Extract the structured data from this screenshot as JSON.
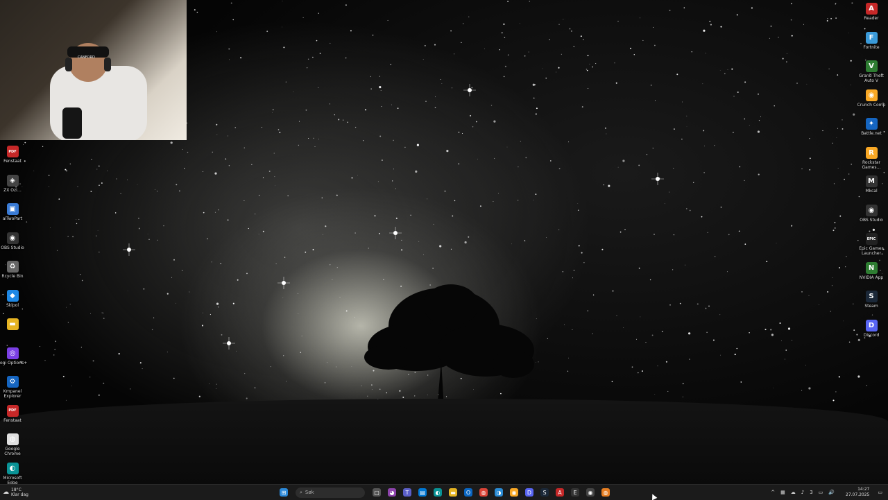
{
  "webcam": {
    "cap_text": "CANFORD"
  },
  "left_icons": [
    {
      "name": "pdf-app",
      "label": "Fenstaat",
      "color": "#c62828",
      "glyph": "PDF"
    },
    {
      "name": "rainmeter",
      "label": "ZX Ozi…",
      "color": "#444",
      "glyph": "◈"
    },
    {
      "name": "network-app",
      "label": "alTwoPart",
      "color": "#3a7bd5",
      "glyph": "▣"
    },
    {
      "name": "obs-studio",
      "label": "OBS Studio",
      "color": "#333",
      "glyph": "◉"
    },
    {
      "name": "recycle-bin",
      "label": "Rcycle Bin",
      "color": "#666",
      "glyph": "♻"
    },
    {
      "name": "shortcut-app",
      "label": "Sklpol",
      "color": "#1e88e5",
      "glyph": "◆"
    },
    {
      "name": "folder",
      "label": "",
      "color": "#e6b422",
      "glyph": "▬"
    },
    {
      "name": "logi-options",
      "label": "Logi Options+",
      "color": "#7b3fe4",
      "glyph": "◎"
    },
    {
      "name": "control-panel",
      "label": "Kmpanel Explorer",
      "color": "#1565c0",
      "glyph": "⚙"
    },
    {
      "name": "pdf-app-2",
      "label": "Fenstaat",
      "color": "#c62828",
      "glyph": "PDF"
    },
    {
      "name": "google-chrome",
      "label": "Google Chrome",
      "color": "#e0e0e0",
      "glyph": "◍"
    },
    {
      "name": "microsoft-edge",
      "label": "Microsoft Edge",
      "color": "#0a9396",
      "glyph": "◐"
    }
  ],
  "right_icons": [
    {
      "name": "adobe-reader",
      "label": "Reader",
      "color": "#c62828",
      "glyph": "A"
    },
    {
      "name": "fortnite",
      "label": "Fortnite",
      "color": "#3a9ad9",
      "glyph": "F"
    },
    {
      "name": "gta-v",
      "label": "Grand Theft Auto V",
      "color": "#2e7d32",
      "glyph": "V"
    },
    {
      "name": "crunchy-app",
      "label": "Crunch Comp",
      "color": "#f9a825",
      "glyph": "◉"
    },
    {
      "name": "battlenet",
      "label": "Battle.net",
      "color": "#1565c0",
      "glyph": "✦"
    },
    {
      "name": "rockstar-games",
      "label": "Rockstar Games…",
      "color": "#f9a825",
      "glyph": "R"
    },
    {
      "name": "mail-app",
      "label": "Mkcal",
      "color": "#333",
      "glyph": "M"
    },
    {
      "name": "obs-studio-2",
      "label": "OBS Studio",
      "color": "#333",
      "glyph": "◉"
    },
    {
      "name": "epic-games",
      "label": "Epic Games Launcher",
      "color": "#222",
      "glyph": "EPIC"
    },
    {
      "name": "nvidia-app",
      "label": "NVIDIA App",
      "color": "#2e7d32",
      "glyph": "N"
    },
    {
      "name": "steam",
      "label": "Steam",
      "color": "#1b2838",
      "glyph": "S"
    },
    {
      "name": "discord",
      "label": "Discord",
      "color": "#5865f2",
      "glyph": "D"
    }
  ],
  "taskbar": {
    "weather_temp": "18°C",
    "weather_desc": "Klar dag",
    "search_placeholder": "Søk",
    "apps": [
      {
        "name": "start",
        "glyph": "⊞",
        "color": "#2b88d8"
      },
      {
        "name": "task-view",
        "glyph": "▢",
        "color": "#555"
      },
      {
        "name": "copilot",
        "glyph": "◕",
        "color": "#8e44ad"
      },
      {
        "name": "teams",
        "glyph": "T",
        "color": "#5b5fc7"
      },
      {
        "name": "store",
        "glyph": "▤",
        "color": "#0078d4"
      },
      {
        "name": "edge",
        "glyph": "◐",
        "color": "#0a9396"
      },
      {
        "name": "file-explorer",
        "glyph": "▬",
        "color": "#e6b422"
      },
      {
        "name": "outlook",
        "glyph": "O",
        "color": "#0a66c2"
      },
      {
        "name": "chrome",
        "glyph": "◍",
        "color": "#db4437"
      },
      {
        "name": "edge-dev",
        "glyph": "◑",
        "color": "#2a8bd4"
      },
      {
        "name": "crunch",
        "glyph": "◉",
        "color": "#f9a825"
      },
      {
        "name": "discord",
        "glyph": "D",
        "color": "#5865f2"
      },
      {
        "name": "steam",
        "glyph": "S",
        "color": "#1b2838"
      },
      {
        "name": "acrobat",
        "glyph": "A",
        "color": "#c62828"
      },
      {
        "name": "epic",
        "glyph": "E",
        "color": "#333"
      },
      {
        "name": "obs",
        "glyph": "◉",
        "color": "#444"
      },
      {
        "name": "chrome-canary",
        "glyph": "◍",
        "color": "#e67e22"
      }
    ],
    "tray_icons": [
      "^",
      "▦",
      "☁",
      "♪",
      "3",
      "▭",
      "🔊"
    ],
    "time": "14:27",
    "date": "27.07.2025"
  }
}
